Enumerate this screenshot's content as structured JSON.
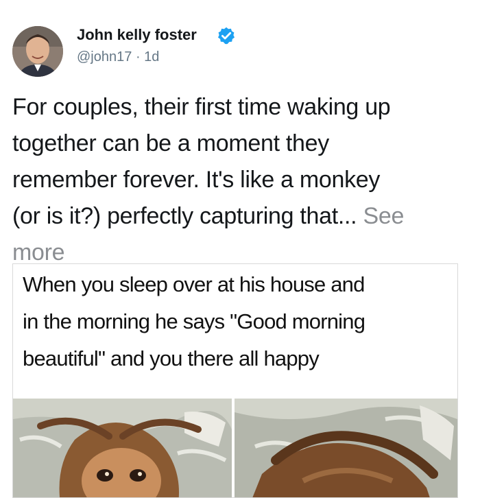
{
  "author": {
    "name": "John kelly foster",
    "handle": "@john17",
    "separator": "·",
    "time": "1d",
    "verified": true,
    "avatar_icon": "profile-photo"
  },
  "post": {
    "text_lines": [
      "For couples, their first time waking up",
      "together can be a moment they",
      "remember forever. It's like a monkey",
      "(or is it?) perfectly capturing that..."
    ],
    "see_more_label": "See",
    "see_more_label_2": "more"
  },
  "media": {
    "caption_lines": [
      "When you sleep over at his house and",
      "in the morning he says \"Good morning",
      "beautiful\" and you there all happy"
    ],
    "images": [
      "monkey-photo-left",
      "monkey-photo-right"
    ]
  },
  "colors": {
    "verified_blue": "#1da1f2",
    "text": "#14171a",
    "muted": "#657786",
    "link_gray": "#8a8d91"
  }
}
